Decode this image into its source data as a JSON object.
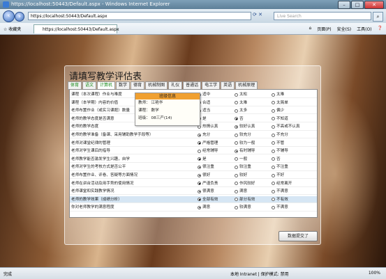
{
  "window": {
    "title": "https://localhost:50443/Default.aspx - Windows Internet Explorer",
    "min": "–",
    "max": "□",
    "close": "✕"
  },
  "address": {
    "url": "https://localhost:50443/Default.aspx",
    "search_placeholder": "Live Search"
  },
  "toolbar": {
    "favorites": "收藏夹",
    "tab_label": "https://localhost:50443/Default.aspx",
    "page": "页面(P)",
    "safety": "安全(S)",
    "tools": "工具(O)",
    "help": "❓"
  },
  "page": {
    "title": "请填写教学评估表",
    "tabs": [
      {
        "label": "体育",
        "green": true
      },
      {
        "label": "语文",
        "green": true
      },
      {
        "label": "计算机",
        "green": true,
        "active": true
      },
      {
        "label": "数学"
      },
      {
        "label": "德育"
      },
      {
        "label": "机械制图"
      },
      {
        "label": "礼仪"
      },
      {
        "label": "普通话"
      },
      {
        "label": "电工学"
      },
      {
        "label": "英语"
      },
      {
        "label": "机械原理"
      }
    ],
    "popup": {
      "header": "班级信息",
      "lines": [
        "教师： 江艳华",
        "课程： 数学",
        "班级： 08三产(14)"
      ]
    },
    "questions": [
      {
        "q": "课程（本次课程）作业与难度",
        "opts": [
          "适中",
          "太松",
          "太难"
        ],
        "sel": 0
      },
      {
        "q": "课程（本学期）内容的价值",
        "opts": [
          "合适",
          "太难",
          "太简单"
        ],
        "sel": 0
      },
      {
        "q": "老师布置作业（或实习课题）数量",
        "opts": [
          "适当",
          "太多",
          "偏少"
        ],
        "sel": 0
      },
      {
        "q": "老师的教学态度是否满意",
        "opts": [
          "是",
          "否",
          "不知道"
        ],
        "sel": 1
      },
      {
        "q": "老师的教学态度",
        "opts": [
          "热情认真",
          "较好认真",
          "不高或不认真"
        ],
        "sel": 1
      },
      {
        "q": "老师的教学准备（备课、采用辅助教学手段等）",
        "opts": [
          "充分",
          "较充分",
          "不充分"
        ],
        "sel": 0
      },
      {
        "q": "老师对课堂纪律的管理",
        "opts": [
          "严格管理",
          "较为一般",
          "不管"
        ],
        "sel": 0
      },
      {
        "q": "老师对学生课后的指导",
        "opts": [
          "经常辅导",
          "有时辅导",
          "不辅导"
        ],
        "sel": 1
      },
      {
        "q": "老师教学能否激发学生兴趣，自学",
        "opts": [
          "是",
          "一般",
          "否"
        ],
        "sel": 0
      },
      {
        "q": "老师对学生的考核方式是否公平",
        "opts": [
          "很注重",
          "较注重",
          "不注重"
        ],
        "sel": 0
      },
      {
        "q": "老师布置作业、评卷、答疑等方面情况",
        "opts": [
          "很好",
          "较好",
          "不好"
        ],
        "sel": 0
      },
      {
        "q": "老师在讲台活动及用手势的使用情况",
        "opts": [
          "严谨负责",
          "作风较好",
          "经常离开"
        ],
        "sel": 0
      },
      {
        "q": "老师课堂和实践教学情况",
        "opts": [
          "很满意",
          "满意",
          "不满意"
        ],
        "sel": 0
      },
      {
        "q": "老师的教学效果（成绩分析）",
        "opts": [
          "全部有效",
          "部分有效",
          "不有效"
        ],
        "sel": 0,
        "highlight": true
      },
      {
        "q": "你对老师教学的满意程度",
        "opts": [
          "满意",
          "较满意",
          "不满意"
        ],
        "sel": 0
      }
    ],
    "submit": "数据提交了"
  },
  "status": {
    "left": "完成",
    "zone": "本地 Intranet | 保护模式: 禁用",
    "zoom": "100%"
  }
}
